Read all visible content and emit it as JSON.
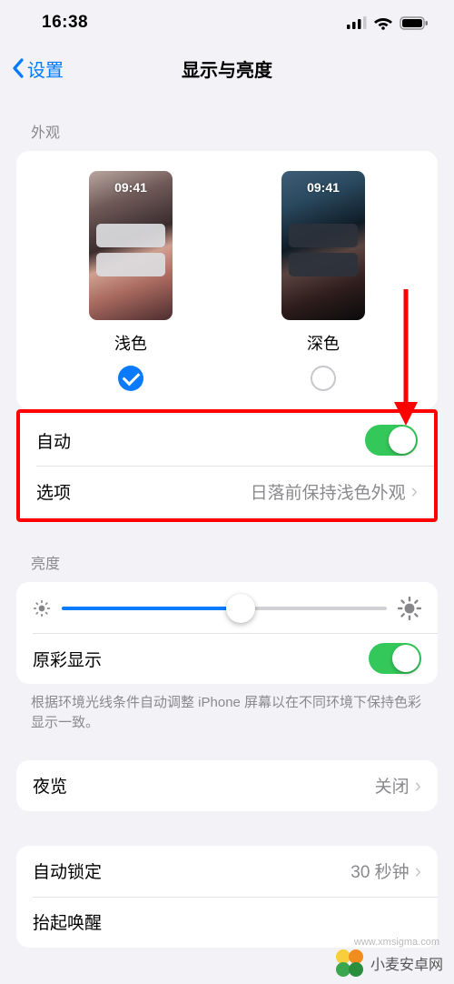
{
  "status": {
    "time": "16:38"
  },
  "nav": {
    "back": "设置",
    "title": "显示与亮度"
  },
  "appearance": {
    "header": "外观",
    "thumb_time": "09:41",
    "light_label": "浅色",
    "dark_label": "深色",
    "auto_label": "自动",
    "auto_on": true,
    "options_label": "选项",
    "options_value": "日落前保持浅色外观"
  },
  "brightness": {
    "header": "亮度",
    "value_pct": 55,
    "truetone_label": "原彩显示",
    "truetone_on": true,
    "footnote": "根据环境光线条件自动调整 iPhone 屏幕以在不同环境下保持色彩显示一致。"
  },
  "nightshift": {
    "label": "夜览",
    "value": "关闭"
  },
  "autolock": {
    "label": "自动锁定",
    "value": "30 秒钟"
  },
  "raise": {
    "label": "抬起唤醒"
  },
  "watermark": {
    "text": "小麦安卓网",
    "url": "www.xmsigma.com"
  }
}
